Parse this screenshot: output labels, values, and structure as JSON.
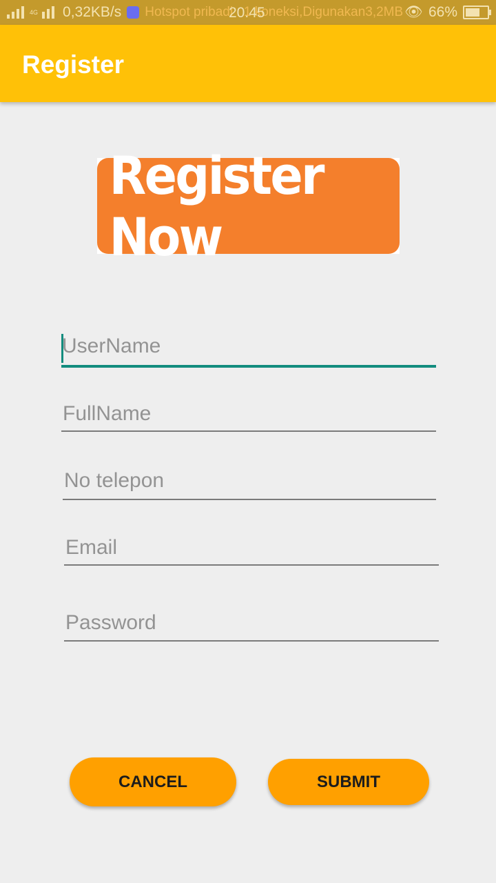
{
  "status_bar": {
    "net_type": "4G",
    "speed": "0,32KB/s",
    "notification": "Hotspot pribadi : 1 koneksi,Digunakan3,2MB",
    "clock": "20.45",
    "battery": "66%",
    "battery_level": 0.66
  },
  "app_bar": {
    "title": "Register"
  },
  "banner": {
    "text": "Register Now"
  },
  "form": {
    "username_placeholder": "UserName",
    "fullname_placeholder": "FullName",
    "phone_placeholder": "No telepon",
    "email_placeholder": "Email",
    "password_placeholder": "Password"
  },
  "buttons": {
    "cancel": "CANCEL",
    "submit": "SUBMIT"
  },
  "colors": {
    "app_bar": "#ffc107",
    "status_bar": "#c49a2c",
    "banner": "#f47f2c",
    "button": "#ffa000",
    "focus": "#128c7e"
  }
}
